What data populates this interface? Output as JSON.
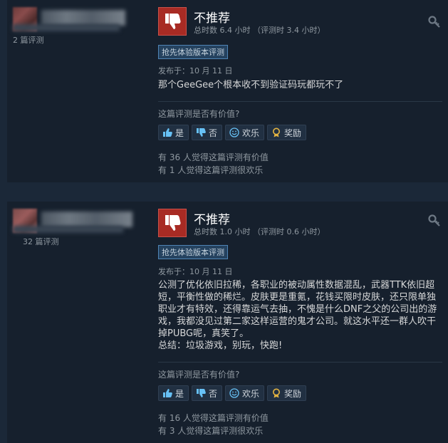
{
  "colors": {
    "background": "#1b2838",
    "card": "#16202d",
    "thumbs_down_bg": "#a82b24",
    "badge_bg": "#25425f",
    "badge_border": "#4f84b5",
    "text_muted": "#8f98a0",
    "text_body": "#d6d7d8"
  },
  "reviews": [
    {
      "author": {
        "review_count": "2 篇评测"
      },
      "verdict_icon": "thumbs-down-icon",
      "title": "不推荐",
      "hours": "总时数 6.4 小时 （评测时 3.4 小时）",
      "badge": "抢先体验版本评测",
      "posted": "发布于：10 月 11 日",
      "content": "那个GeeGee个根本收不到验证码玩都玩不了",
      "helpful_question": "这篇评测是否有价值?",
      "buttons": {
        "yes": "是",
        "no": "否",
        "funny": "欢乐",
        "award": "奖励"
      },
      "stats": {
        "helpful": "有 36 人觉得这篇评测有价值",
        "funny": "有 1 人觉得这篇评测很欢乐"
      }
    },
    {
      "author": {
        "review_count": "32 篇评测"
      },
      "verdict_icon": "thumbs-down-icon",
      "title": "不推荐",
      "hours": "总时数 1.0 小时 （评测时 0.6 小时）",
      "badge": "抢先体验版本评测",
      "posted": "发布于：10 月 11 日",
      "content": "公测了优化依旧拉稀，各职业的被动属性数据混乱，武器TTK依旧超\n短，平衡性做的稀烂。皮肤更是重氪，花钱买限时皮肤，还只限单独\n职业才有特效，还得靠运气去抽，不愧是什么DNF之父的公司出的游\n戏，我都没见过第二家这样运营的鬼才公司。就这水平还一群人吹干\n掉PUBG呢，真笑了。\n总结：垃圾游戏，别玩，快跑!",
      "helpful_question": "这篇评测是否有价值?",
      "buttons": {
        "yes": "是",
        "no": "否",
        "funny": "欢乐",
        "award": "奖励"
      },
      "stats": {
        "helpful": "有 16 人觉得这篇评测有价值",
        "funny": "有 3 人觉得这篇评测很欢乐"
      }
    }
  ]
}
